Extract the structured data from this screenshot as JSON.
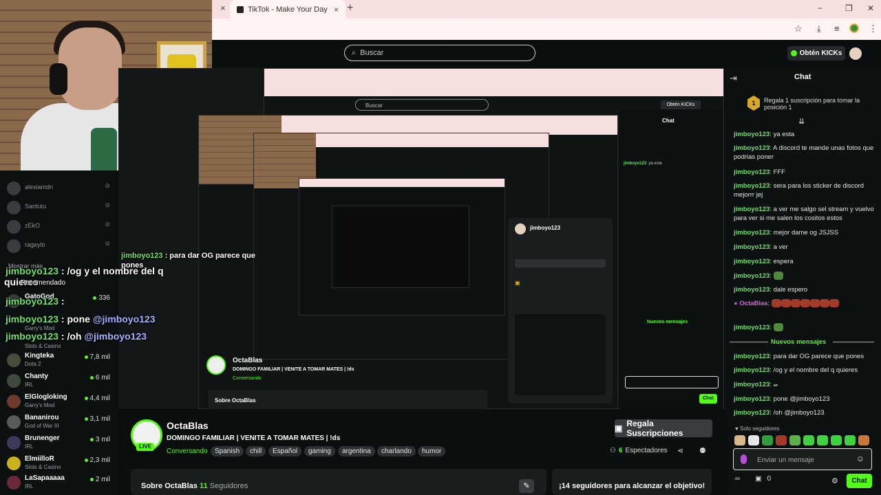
{
  "browser": {
    "tab_title": "TikTok - Make Your Day",
    "tab_close": "×",
    "new_tab": "+",
    "win_min": "−",
    "win_max": "❐",
    "win_close": "✕"
  },
  "header": {
    "search_placeholder": "Buscar",
    "kicks_label": "Obtén KICKs"
  },
  "sidebar": {
    "offline": [
      {
        "name": "alexiamdn"
      },
      {
        "name": "Santutu"
      },
      {
        "name": "zEkO"
      },
      {
        "name": "rageylo"
      }
    ],
    "show_more": "Mostrar más",
    "live": [
      {
        "name": "GatoGod",
        "category": "",
        "count": "336"
      },
      {
        "name": "",
        "category": "Garry's Mod",
        "count": ""
      },
      {
        "name": "",
        "category": "Slots & Casino",
        "count": ""
      },
      {
        "name": "Kingteka",
        "category": "Dota 2",
        "count": "7,8 mil"
      },
      {
        "name": "Chanty",
        "category": "IRL",
        "count": "6 mil"
      },
      {
        "name": "ElGlogloking",
        "category": "Garry's Mod",
        "count": "4,4 mil"
      },
      {
        "name": "Bananirou",
        "category": "God of War III",
        "count": "3,1 mil"
      },
      {
        "name": "Brunenger",
        "category": "IRL",
        "count": "3 mil"
      },
      {
        "name": "ElmiilloR",
        "category": "Slots & Casino",
        "count": "2,3 mil"
      },
      {
        "name": "LaSapaaaaa",
        "category": "IRL",
        "count": "2 mil"
      }
    ]
  },
  "overlay": {
    "line1_user": "jimboyo123",
    "line1_text": " : /og y el nombre del q",
    "line1b": "quieres",
    "line1c": "Recomendado",
    "line2_user": "jimboyo123",
    "line2_text": " : ",
    "line3_user": "jimboyo123",
    "line3_text": " : pone ",
    "line3_mention": "@jimboyo123",
    "line4_user": "jimboyo123",
    "line4_text": " : /oh ",
    "line4_mention": "@jimboyo123",
    "line5_user": "jimboyo123",
    "line5_text": " : para dar OG parece que",
    "line5b": "pones"
  },
  "channel": {
    "name": "OctaBlas",
    "live": "LIVE",
    "title": "DOMINGO FAMILIAR | VENITE A TOMAR MATES | !ds",
    "category": "Conversando",
    "tags": [
      "Spanish",
      "chill",
      "Español",
      "gaming",
      "argentina",
      "charlando",
      "humor"
    ],
    "subs_button": "Regala Suscripciones",
    "viewers_count": "6",
    "viewers_label": "Espectadores",
    "about_title": "Sobre OctaBlas",
    "followers_count": "11",
    "followers_label": "Seguidores",
    "goal_text": "¡14 seguidores para alcanzar el objetivo!"
  },
  "chat": {
    "title": "Chat",
    "sub_badge": "1",
    "sub_banner": "Regala 1 suscripción para tomar la posición 1",
    "messages": [
      {
        "user": "jimboyo123",
        "text": "ya esta"
      },
      {
        "user": "jimboyo123",
        "text": "A discord te mande unas fotos que podrias poner"
      },
      {
        "user": "jimboyo123",
        "text": "FFF"
      },
      {
        "user": "jimboyo123",
        "text": "sera para los sticker de discord mejorrr jej"
      },
      {
        "user": "jimboyo123",
        "text": "a ver me salgo sel stream y vuelvo para ver si me salen los cositos estos"
      },
      {
        "user": "jimboyo123",
        "text": "mejor dame og JSJSS"
      },
      {
        "user": "jimboyo123",
        "text": "a ver"
      },
      {
        "user": "jimboyo123",
        "text": "espera"
      },
      {
        "user": "jimboyo123",
        "text": ""
      },
      {
        "user": "jimboyo123",
        "text": "dale espero"
      },
      {
        "user": "OctaBlas",
        "text": ""
      },
      {
        "user": "jimboyo123",
        "text": ""
      }
    ],
    "new_messages": "Nuevos mensajes",
    "new": [
      {
        "user": "jimboyo123",
        "text": "para dar OG parece que pones"
      },
      {
        "user": "jimboyo123",
        "text": "/og y el nombre del q quieres"
      },
      {
        "user": "jimboyo123",
        "text": ""
      },
      {
        "user": "jimboyo123",
        "text": "pone @jimboyo123"
      },
      {
        "user": "jimboyo123",
        "text": "/oh @jimboyo123"
      }
    ],
    "followers_only": "Solo seguidores",
    "input_placeholder": "Enviar un mensaje",
    "kicks_count": "0",
    "send_label": "Chat"
  },
  "colors": {
    "accent": "#53fc18",
    "username": "#6ee26b",
    "background": "#0b0e0f",
    "tab_bar": "#f8dfe0"
  }
}
